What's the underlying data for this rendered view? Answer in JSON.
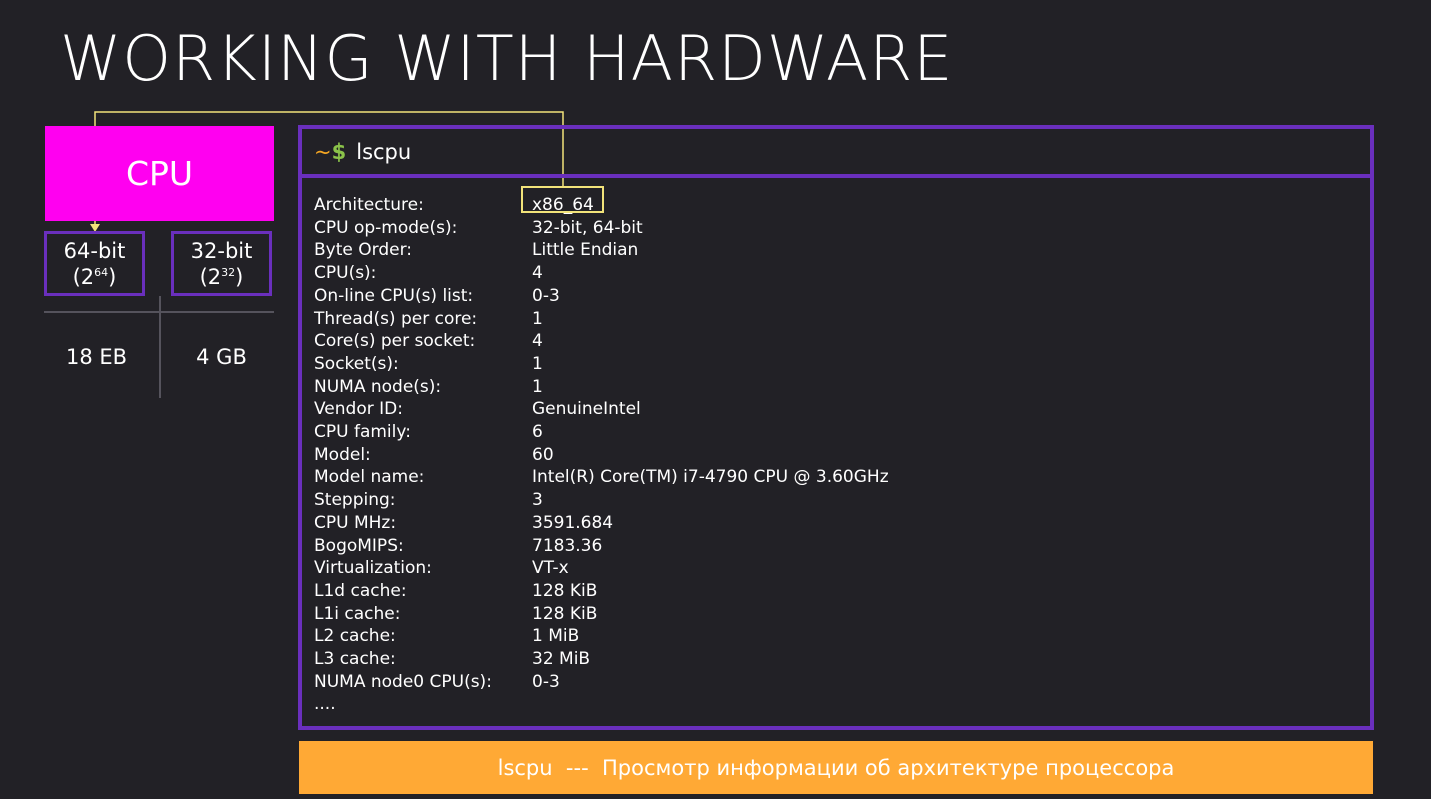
{
  "slide": {
    "title": "WORKING WITH HARDWARE"
  },
  "cpu": {
    "label": "CPU",
    "arch64": {
      "label": "64-bit",
      "power_base": "(2",
      "power_exp": "64",
      "power_close": ")",
      "memory": "18 EB"
    },
    "arch32": {
      "label": "32-bit",
      "power_base": "(2",
      "power_exp": "32",
      "power_close": ")",
      "memory": "4 GB"
    }
  },
  "terminal": {
    "prompt_tilde": "~",
    "prompt_dollar": "$",
    "command": "lscpu",
    "rows": [
      {
        "k": "Architecture:",
        "v": "x86_64"
      },
      {
        "k": "CPU op-mode(s):",
        "v": "32-bit, 64-bit"
      },
      {
        "k": "Byte Order:",
        "v": "Little Endian"
      },
      {
        "k": "CPU(s):",
        "v": "4"
      },
      {
        "k": "On-line CPU(s) list:",
        "v": "0-3"
      },
      {
        "k": "Thread(s) per core:",
        "v": "1"
      },
      {
        "k": "Core(s) per socket:",
        "v": "4"
      },
      {
        "k": "Socket(s):",
        "v": "1"
      },
      {
        "k": "NUMA node(s):",
        "v": "1"
      },
      {
        "k": "Vendor ID:",
        "v": "GenuineIntel"
      },
      {
        "k": "CPU family:",
        "v": "6"
      },
      {
        "k": "Model:",
        "v": "60"
      },
      {
        "k": "Model name:",
        "v": "Intel(R) Core(TM) i7-4790 CPU @ 3.60GHz"
      },
      {
        "k": "Stepping:",
        "v": "3"
      },
      {
        "k": "CPU MHz:",
        "v": "3591.684"
      },
      {
        "k": "BogoMIPS:",
        "v": "7183.36"
      },
      {
        "k": "Virtualization:",
        "v": "VT-x"
      },
      {
        "k": "L1d cache:",
        "v": "128 KiB"
      },
      {
        "k": "L1i cache:",
        "v": "128 KiB"
      },
      {
        "k": "L2 cache:",
        "v": "1 MiB"
      },
      {
        "k": "L3 cache:",
        "v": "32 MiB"
      },
      {
        "k": "NUMA node0 CPU(s):",
        "v": "0-3"
      },
      {
        "k": "....",
        "v": ""
      }
    ]
  },
  "banner": {
    "text": "lscpu  ---  Просмотр информации об архитектуре процессора"
  },
  "colors": {
    "background": "#222126",
    "accent_purple": "#6a2fbd",
    "cpu_magenta": "#ff00f0",
    "banner_orange": "#ffa935",
    "highlight_yellow": "#f2e37a"
  }
}
